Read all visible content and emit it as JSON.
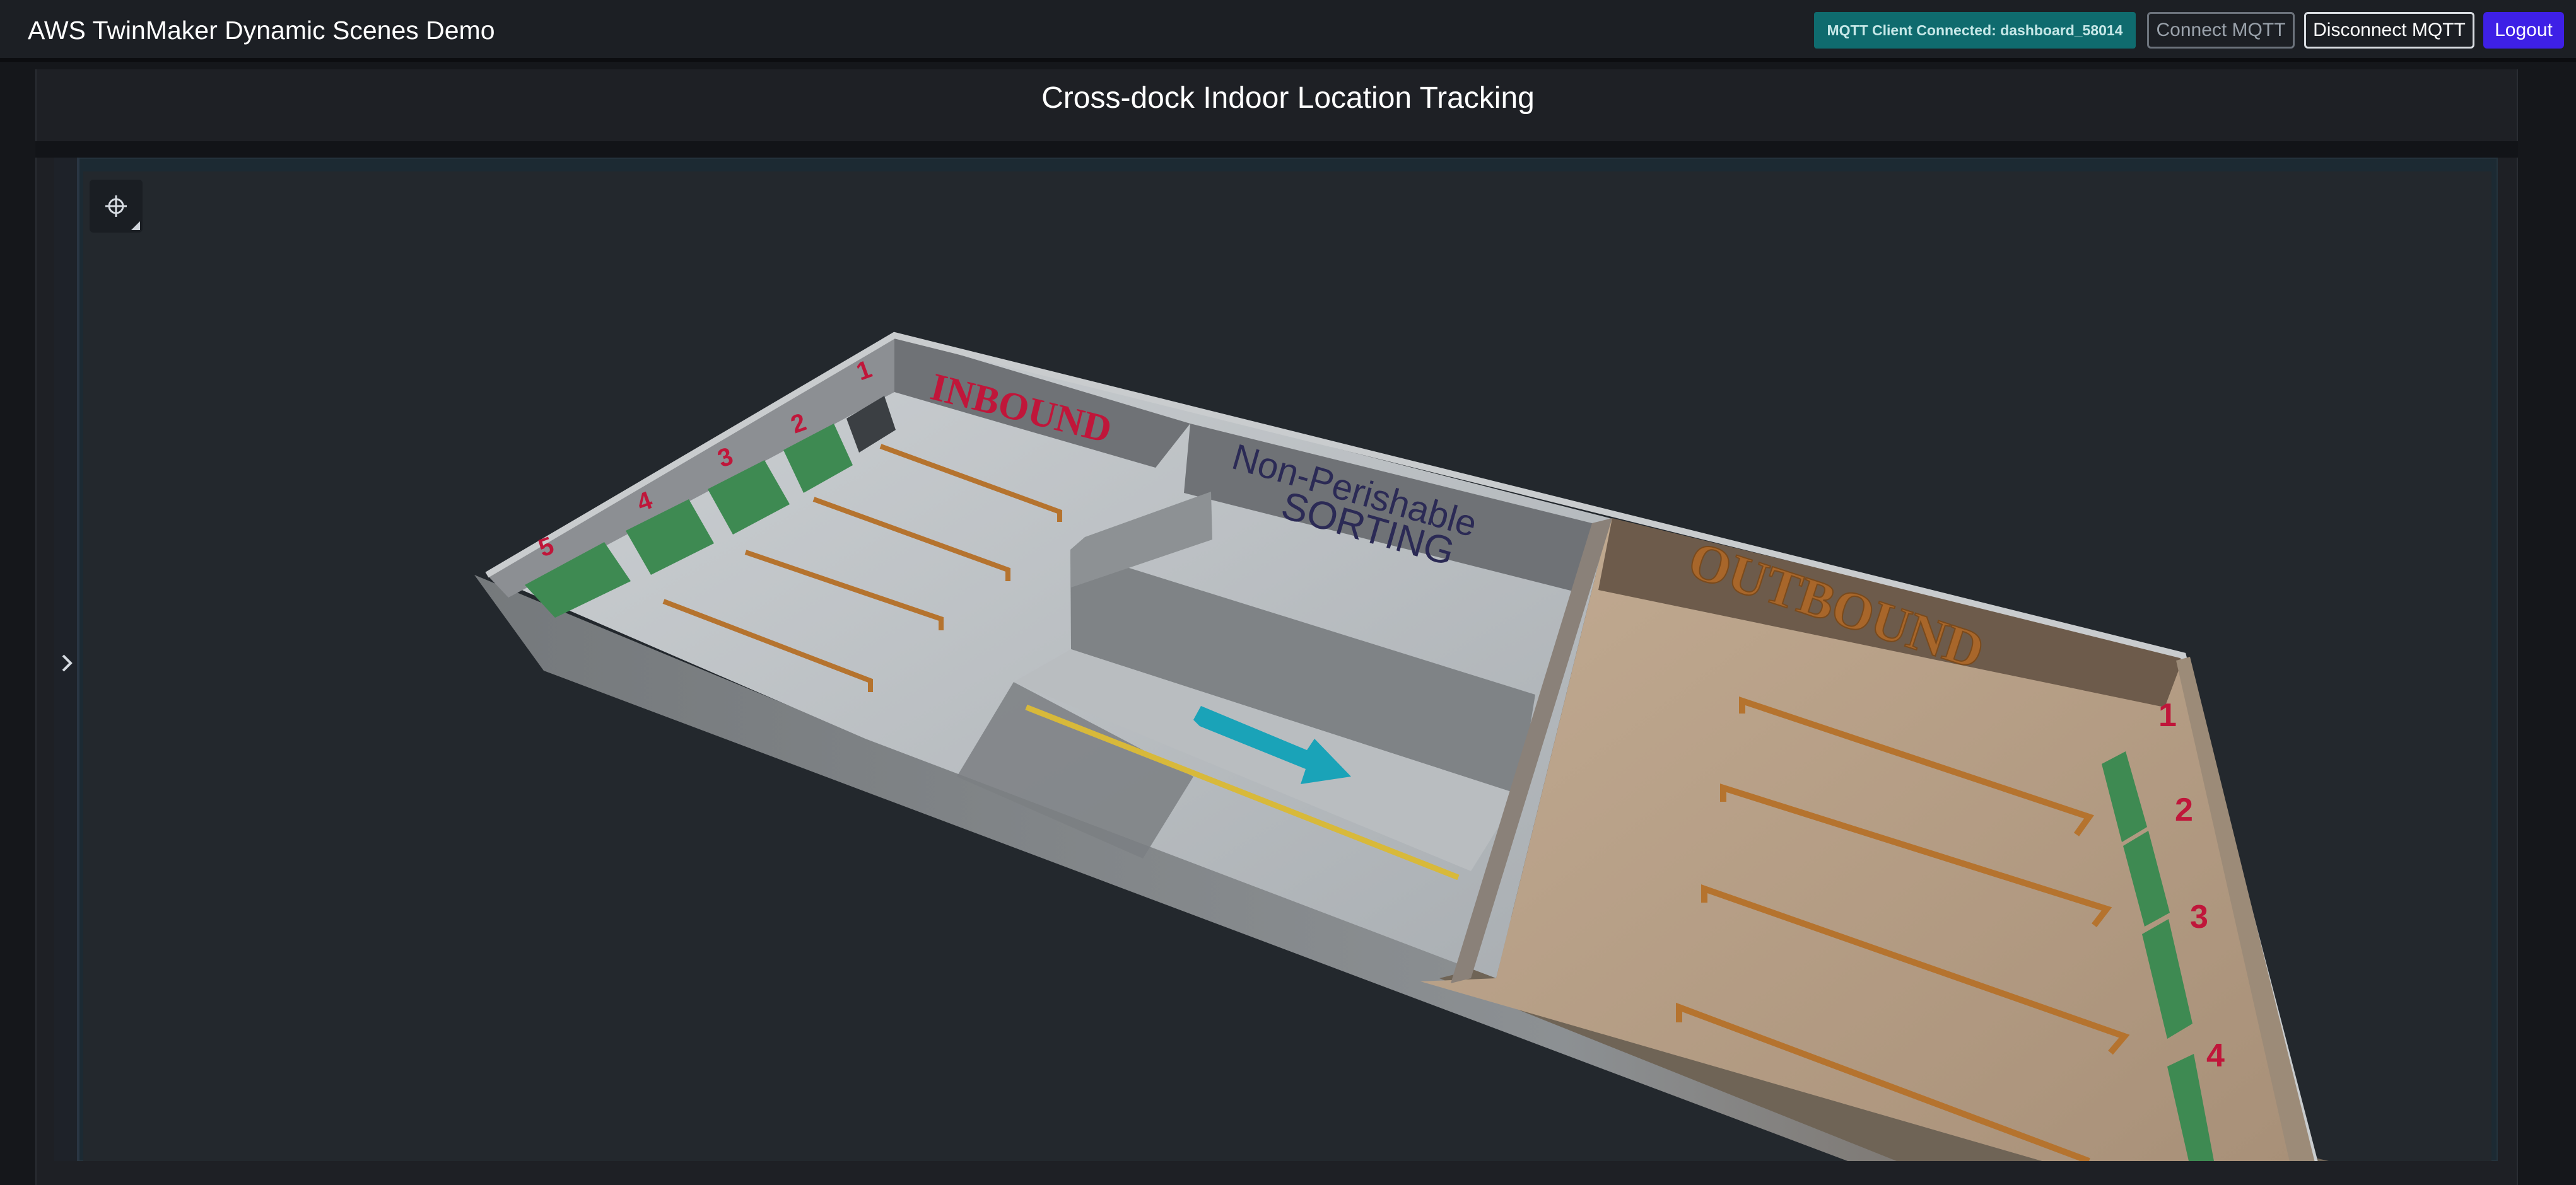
{
  "header": {
    "app_title": "AWS TwinMaker Dynamic Scenes Demo",
    "mqtt_status": "MQTT Client Connected: dashboard_58014",
    "connect_label": "Connect MQTT",
    "disconnect_label": "Disconnect MQTT",
    "logout_label": "Logout"
  },
  "panel": {
    "title": "Cross-dock Indoor Location Tracking"
  },
  "scene": {
    "zone_inbound": "INBOUND",
    "zone_sorting_line1": "Non-Perishable",
    "zone_sorting_line2": "SORTING",
    "zone_outbound": "OUTBOUND",
    "inbound_doors": [
      "5",
      "4",
      "3",
      "2",
      "1"
    ],
    "outbound_doors": [
      "1",
      "2",
      "3",
      "4"
    ]
  },
  "colors": {
    "accent_status": "#0f6b6e",
    "logout": "#3e20e6",
    "door_green": "#3e8a52",
    "rail_orange": "#b5732e",
    "inbound_text": "#c0163a",
    "sorting_text": "#2b2a55",
    "outbound_text": "#a8662a",
    "flow_arrow": "#1aa3b8"
  },
  "icons": {
    "gizmo": "move-gizmo-icon",
    "sidebar_toggle": "chevron-right-icon"
  }
}
